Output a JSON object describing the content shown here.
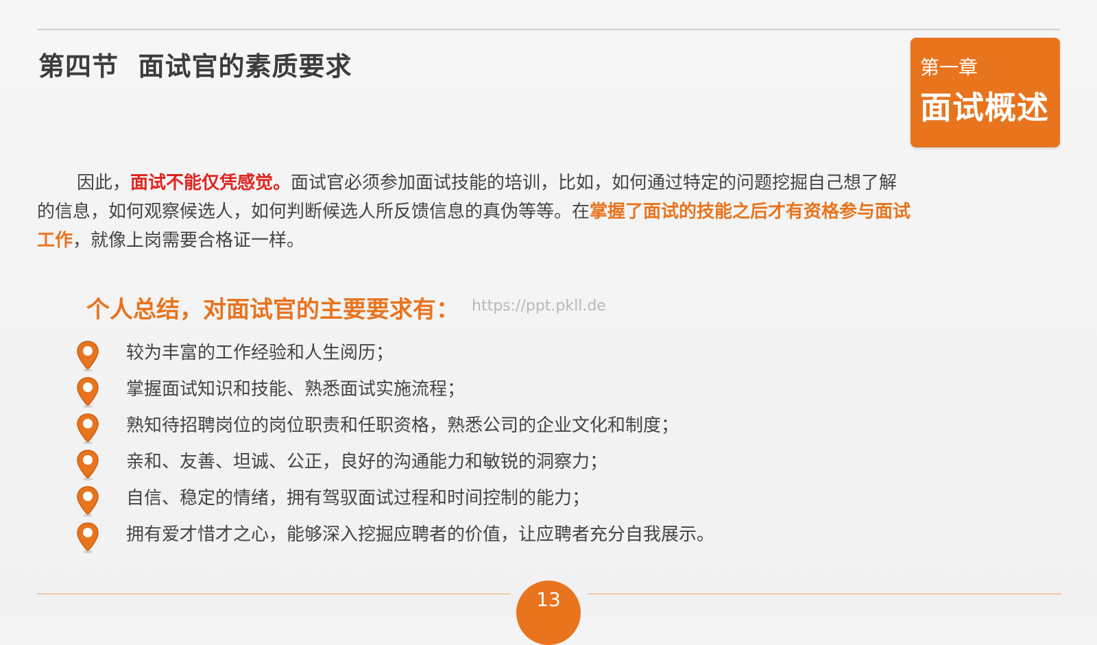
{
  "header": {
    "section_title": "第四节  面试官的素质要求"
  },
  "chapter": {
    "number_label": "第一章",
    "name": "面试概述"
  },
  "paragraph": {
    "part1": "因此，",
    "highlight_red": "面试不能仅凭感觉。",
    "part2": "面试官必须参加面试技能的培训，比如，如何通过特定的问题挖掘自己想了解的信息，如何观察候选人，如何判断候选人所反馈信息的真伪等等。在",
    "highlight_orange": "掌握了面试的技能之后才有资格参与面试工作",
    "part3": "，就像上岗需要合格证一样。"
  },
  "summary": {
    "heading": "个人总结，对面试官的主要要求有：",
    "watermark": "https://ppt.pkll.de",
    "items": [
      {
        "text": "较为丰富的工作经验和人生阅历；"
      },
      {
        "text": "掌握面试知识和技能、熟悉面试实施流程；"
      },
      {
        "text": "熟知待招聘岗位的岗位职责和任职资格，熟悉公司的企业文化和制度；"
      },
      {
        "text": "亲和、友善、坦诚、公正，良好的沟通能力和敏锐的洞察力；"
      },
      {
        "text": "自信、稳定的情绪，拥有驾驭面试过程和时间控制的能力；"
      },
      {
        "text": "拥有爱才惜才之心，能够深入挖掘应聘者的价值，让应聘者充分自我展示。"
      }
    ],
    "bullet_icon": "location-pin-icon"
  },
  "footer": {
    "page_number": "13"
  },
  "colors": {
    "accent": "#e8741e",
    "highlight_red": "#e0231f",
    "body_text": "#444444",
    "title_text": "#3c3c3c"
  }
}
